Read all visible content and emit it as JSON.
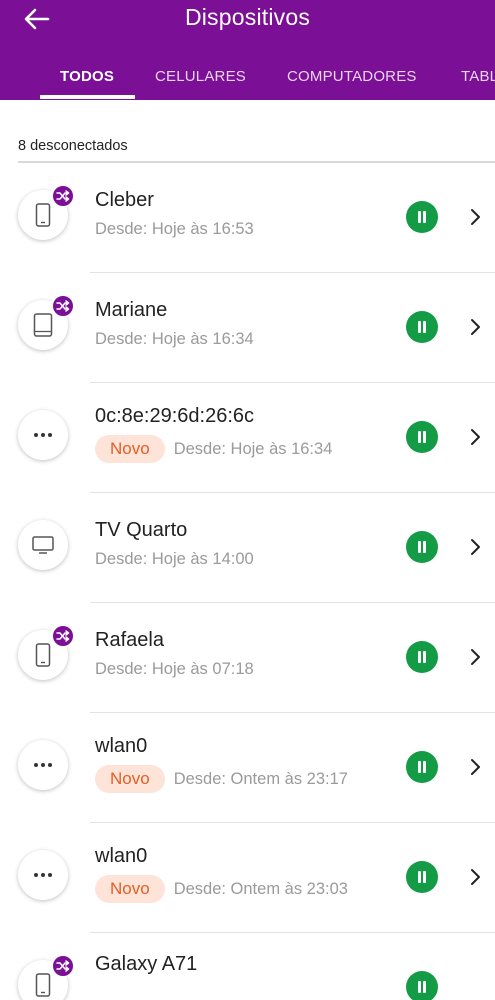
{
  "appbar": {
    "title": "Dispositivos",
    "back_icon": "arrow-left-icon"
  },
  "tabs": [
    {
      "label": "TODOS",
      "active": true
    },
    {
      "label": "CELULARES",
      "active": false
    },
    {
      "label": "COMPUTADORES",
      "active": false
    },
    {
      "label": "TABL",
      "active": false
    }
  ],
  "section": {
    "header": "8 desconectados"
  },
  "colors": {
    "primary": "#7b0f95",
    "pause_green": "#139b45",
    "new_badge_bg": "#fde3d8",
    "new_badge_text": "#e35f25"
  },
  "devices": [
    {
      "name": "Cleber",
      "is_new": false,
      "new_label": "",
      "since": "Desde: Hoje às 16:53",
      "icon": "smartphone-icon",
      "shared": true
    },
    {
      "name": "Mariane",
      "is_new": false,
      "new_label": "",
      "since": "Desde: Hoje às 16:34",
      "icon": "tablet-icon",
      "shared": true
    },
    {
      "name": "0c:8e:29:6d:26:6c",
      "is_new": true,
      "new_label": "Novo",
      "since": "Desde: Hoje às 16:34",
      "icon": "more-horizontal-icon",
      "shared": false
    },
    {
      "name": "TV Quarto",
      "is_new": false,
      "new_label": "",
      "since": "Desde: Hoje às 14:00",
      "icon": "tv-icon",
      "shared": false
    },
    {
      "name": "Rafaela",
      "is_new": false,
      "new_label": "",
      "since": "Desde: Hoje às 07:18",
      "icon": "smartphone-icon",
      "shared": true
    },
    {
      "name": "wlan0",
      "is_new": true,
      "new_label": "Novo",
      "since": "Desde: Ontem às 23:17",
      "icon": "more-horizontal-icon",
      "shared": false
    },
    {
      "name": "wlan0",
      "is_new": true,
      "new_label": "Novo",
      "since": "Desde: Ontem às 23:03",
      "icon": "more-horizontal-icon",
      "shared": false
    },
    {
      "name": "Galaxy A71",
      "is_new": false,
      "new_label": "",
      "since": "",
      "icon": "smartphone-icon",
      "shared": true
    }
  ]
}
